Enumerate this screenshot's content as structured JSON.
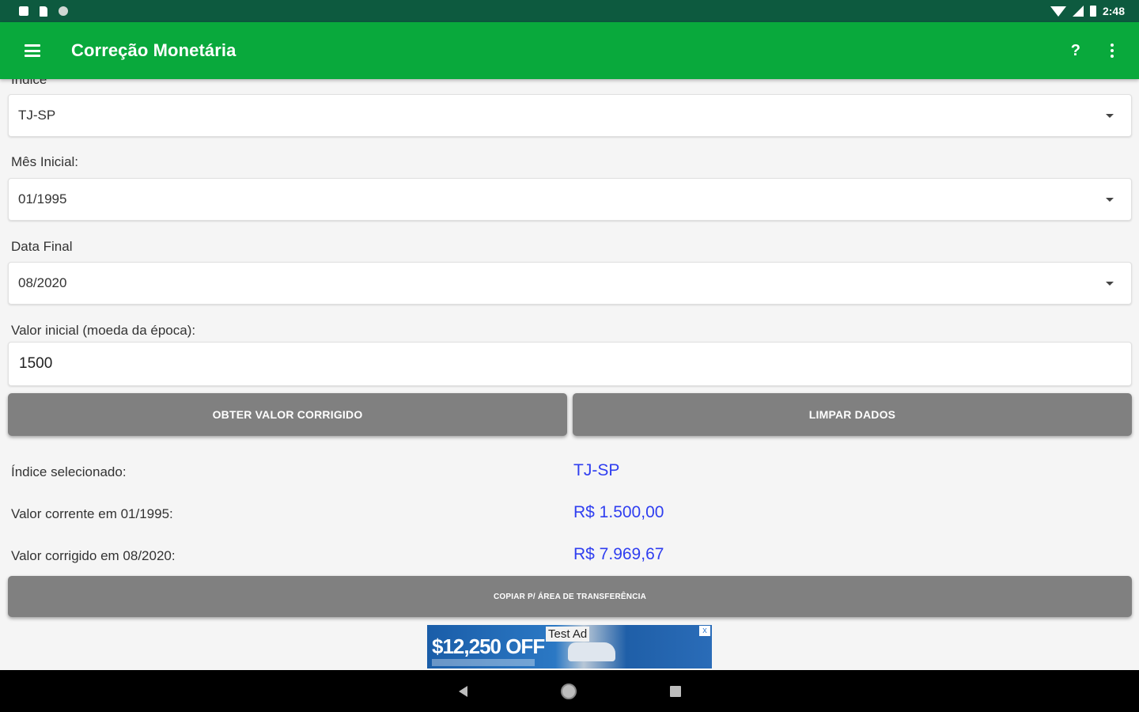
{
  "status_bar": {
    "time": "2:48"
  },
  "toolbar": {
    "title": "Correção Monetária",
    "help_label": "?"
  },
  "form": {
    "indice_label": "Índice",
    "indice_value": "TJ-SP",
    "mes_inicial_label": "Mês Inicial:",
    "mes_inicial_value": "01/1995",
    "data_final_label": "Data Final",
    "data_final_value": "08/2020",
    "valor_inicial_label": "Valor inicial (moeda da época):",
    "valor_inicial_value": "1500"
  },
  "buttons": {
    "obter": "OBTER VALOR CORRIGIDO",
    "limpar": "LIMPAR DADOS",
    "copiar": "COPIAR P/ ÁREA DE TRANSFERÊNCIA"
  },
  "results": {
    "indice_label": "Índice selecionado:",
    "indice_value": "TJ-SP",
    "corrente_label": "Valor corrente em 01/1995:",
    "corrente_value": "R$ 1.500,00",
    "corrigido_label": "Valor corrigido em 08/2020:",
    "corrigido_value": "R$ 7.969,67"
  },
  "ad": {
    "price": "$12,250 OFF",
    "tag": "Test Ad",
    "close": "x"
  },
  "colors": {
    "status_bar": "#0d5a3f",
    "toolbar": "#09a93c",
    "result_value": "#2f3ef0",
    "button": "#808080"
  },
  "icons": [
    "menu-icon",
    "help-icon",
    "more-vert-icon",
    "caret-down-icon",
    "back-icon",
    "home-icon",
    "recents-icon",
    "wifi-icon",
    "cell-signal-icon",
    "battery-icon"
  ]
}
